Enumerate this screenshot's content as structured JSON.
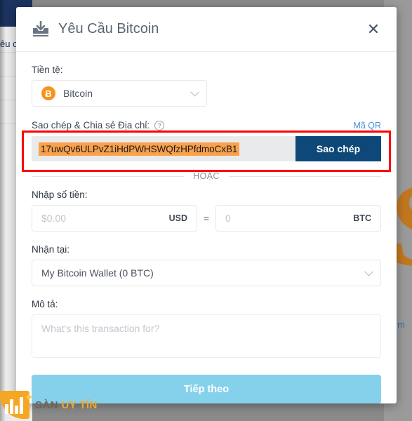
{
  "background": {
    "sidebar_text": "êu c",
    "decor_dollar": "$",
    "decor_text": "m"
  },
  "watermark": {
    "text_1": "SÀN ",
    "text_2": "UY TÍN",
    "star_icon": "star-icon"
  },
  "modal": {
    "title": "Yêu Cầu Bitcoin",
    "title_icon": "inbox-download-icon",
    "close_label": "✕",
    "currency": {
      "label": "Tiền tệ:",
      "selected": "Bitcoin",
      "icon": "bitcoin-icon",
      "icon_glyph": "Ƀ"
    },
    "address": {
      "label": "Sao chép & Chia sẻ Địa chỉ:",
      "help_glyph": "?",
      "qr_link": "Mã QR",
      "value": "17uwQv6ULPvZ1iHdPWHSWQfzHPfdmoCxB1",
      "copy_button": "Sao chép"
    },
    "divider_text": "HOẶC",
    "amount": {
      "label": "Nhập số tiền:",
      "usd_placeholder": "$0.00",
      "usd_unit": "USD",
      "equals": "=",
      "btc_placeholder": "0",
      "btc_unit": "BTC"
    },
    "wallet": {
      "label": "Nhận tại:",
      "selected": "My Bitcoin Wallet (0 BTC)"
    },
    "description": {
      "label": "Mô tả:",
      "placeholder": "What's this transaction for?"
    },
    "submit_button": "Tiếp theo"
  },
  "colors": {
    "copy_button": "#0d4878",
    "submit_button": "#85d1ec",
    "highlight": "#f9a14c",
    "bitcoin_orange": "#f7931a",
    "annotation_red": "#ff0000",
    "link_blue": "#4a90d9"
  }
}
